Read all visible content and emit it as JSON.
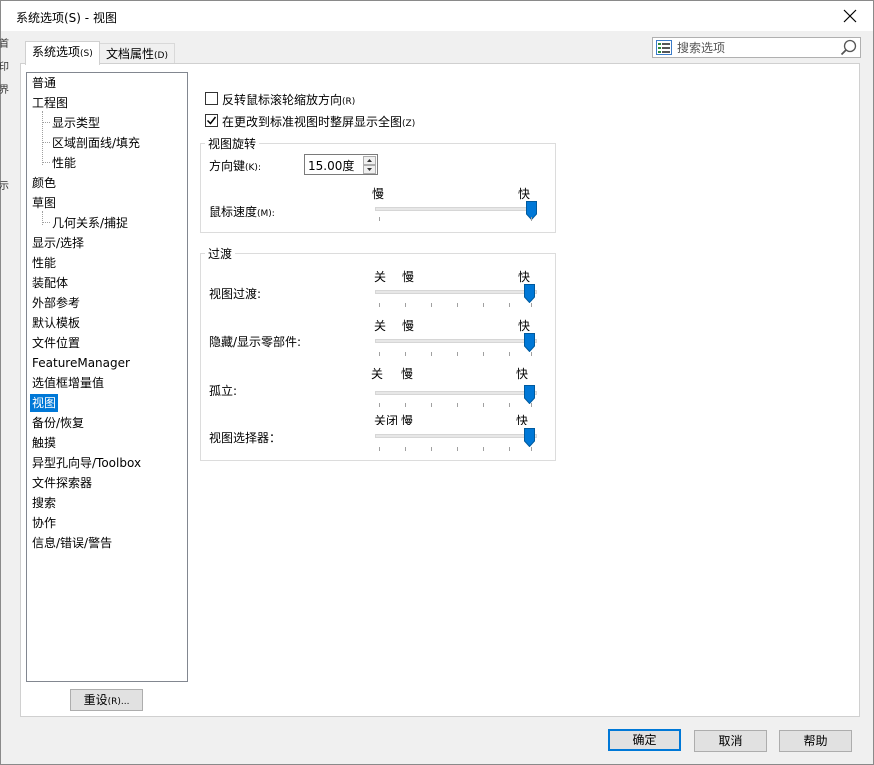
{
  "window": {
    "title": "系统选项(S) - 视图",
    "close_glyph": "✕"
  },
  "edge_glyphs": [
    "首",
    "印",
    "界",
    "示"
  ],
  "tabs": [
    {
      "label": "系统选项",
      "suffix": "(S)",
      "active": true
    },
    {
      "label": "文档属性",
      "suffix": "(D)",
      "active": false
    }
  ],
  "search": {
    "placeholder": "搜索选项",
    "icon": "search-icon"
  },
  "tree": {
    "items": [
      {
        "label": "普通",
        "level": 0
      },
      {
        "label": "工程图",
        "level": 0
      },
      {
        "label": "显示类型",
        "level": 1
      },
      {
        "label": "区域剖面线/填充",
        "level": 1
      },
      {
        "label": "性能",
        "level": 1
      },
      {
        "label": "颜色",
        "level": 0
      },
      {
        "label": "草图",
        "level": 0
      },
      {
        "label": "几何关系/捕捉",
        "level": 1
      },
      {
        "label": "显示/选择",
        "level": 0
      },
      {
        "label": "性能",
        "level": 0
      },
      {
        "label": "装配体",
        "level": 0
      },
      {
        "label": "外部参考",
        "level": 0
      },
      {
        "label": "默认模板",
        "level": 0
      },
      {
        "label": "文件位置",
        "level": 0
      },
      {
        "label": "FeatureManager",
        "level": 0
      },
      {
        "label": "选值框增量值",
        "level": 0
      },
      {
        "label": "视图",
        "level": 0,
        "selected": true
      },
      {
        "label": "备份/恢复",
        "level": 0
      },
      {
        "label": "触摸",
        "level": 0
      },
      {
        "label": "异型孔向导/Toolbox",
        "level": 0
      },
      {
        "label": "文件探索器",
        "level": 0
      },
      {
        "label": "搜索",
        "level": 0
      },
      {
        "label": "协作",
        "level": 0
      },
      {
        "label": "信息/错误/警告",
        "level": 0
      }
    ]
  },
  "reset_button": {
    "label": "重设",
    "suffix": "(R)..."
  },
  "options": {
    "reverse_wheel": {
      "label": "反转鼠标滚轮缩放方向",
      "suffix": "(R)",
      "checked": false
    },
    "zoom_to_fit": {
      "label": "在更改到标准视图时整屏显示全图",
      "suffix": "(Z)",
      "checked": true
    }
  },
  "view_rotation": {
    "title": "视图旋转",
    "arrow_keys": {
      "label": "方向键",
      "suffix": "(K):",
      "value": "15.00度"
    },
    "mouse_speed": {
      "label": "鼠标速度",
      "suffix": "(M):",
      "slow": "慢",
      "fast": "快",
      "level": 1.0
    }
  },
  "transitions": {
    "title": "过渡",
    "sliders": [
      {
        "label": "视图过渡:",
        "off": "关",
        "slow": "慢",
        "fast": "快",
        "level": 1.0
      },
      {
        "label": "隐藏/显示零部件:",
        "off": "关",
        "slow": "慢",
        "fast": "快",
        "level": 1.0
      },
      {
        "label": "孤立:",
        "off": "关",
        "slow": "慢",
        "fast": "快",
        "level": 1.0
      },
      {
        "label": "视图选择器：",
        "off": "关闭",
        "slow": "慢",
        "fast": "快",
        "level": 1.0
      }
    ]
  },
  "footer": {
    "ok_label": "确定",
    "cancel_label": "取消",
    "help_label": "帮助"
  },
  "colors": {
    "accent": "#0078d7",
    "selection": "#0078d7"
  }
}
